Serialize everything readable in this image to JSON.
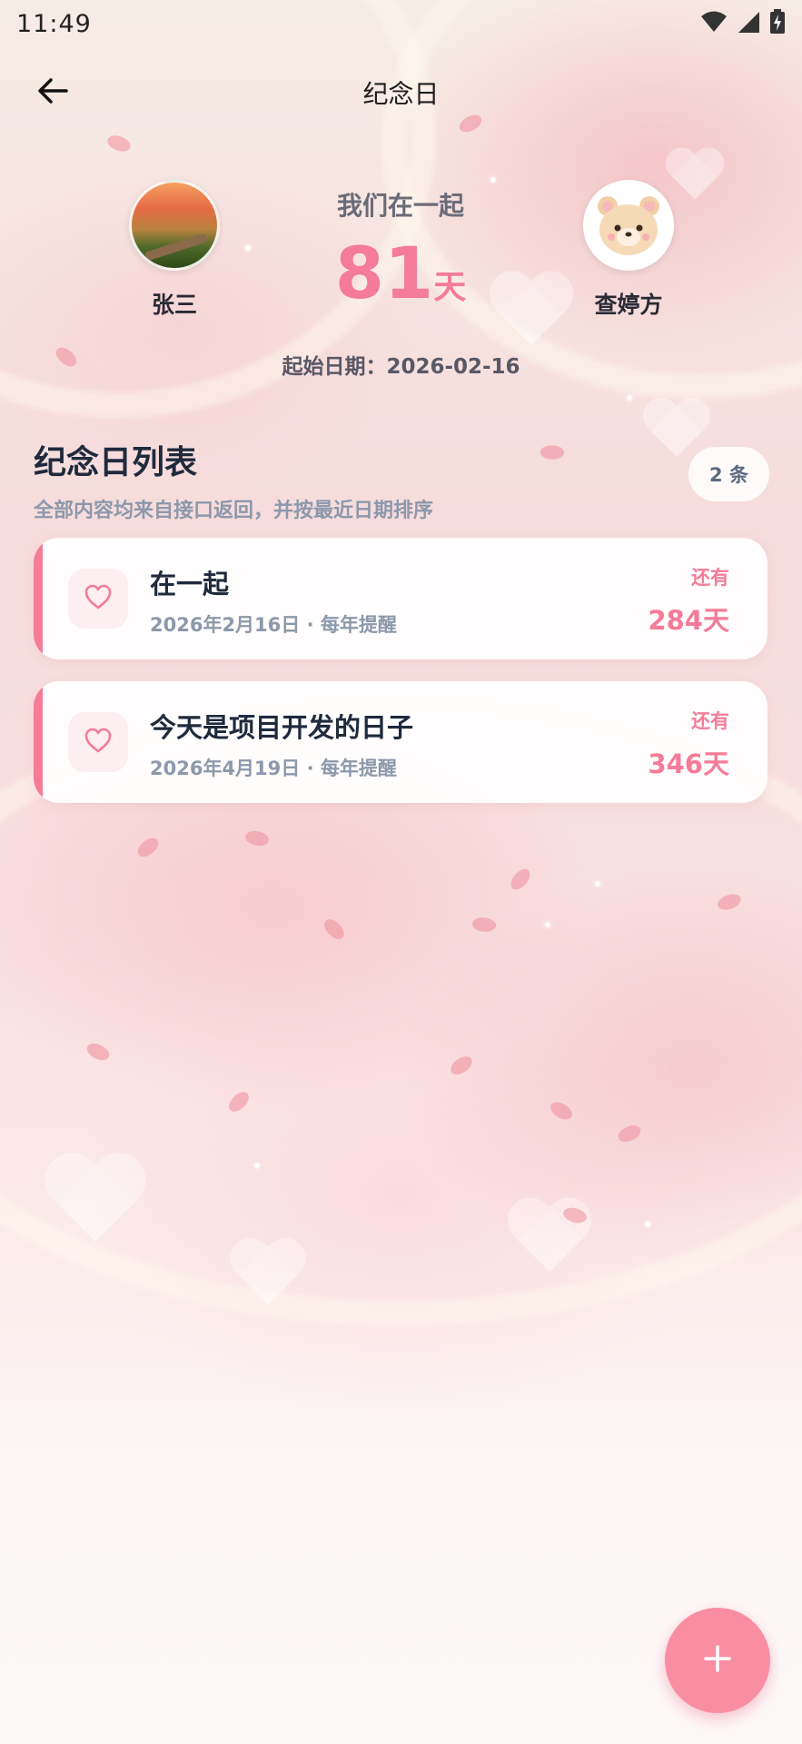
{
  "status_bar": {
    "time": "11:49",
    "icons": [
      "wifi-icon",
      "signal-icon",
      "battery-charging-icon"
    ]
  },
  "app_bar": {
    "title": "纪念日",
    "back_icon": "arrow-left-icon"
  },
  "couple": {
    "left_person": {
      "name": "张三",
      "avatar": "great-wall-landscape-photo"
    },
    "right_person": {
      "name": "查婷方",
      "avatar": "bear-cartoon"
    },
    "together_label": "我们在一起",
    "days_number": "81",
    "days_unit": "天",
    "start_date": "起始日期：2026-02-16"
  },
  "list": {
    "title": "纪念日列表",
    "subtitle": "全部内容均来自接口返回，并按最近日期排序",
    "count_badge": "2 条",
    "items": [
      {
        "title": "在一起",
        "meta": "2026年2月16日 · 每年提醒",
        "remain_label": "还有",
        "remain_days": "284天",
        "icon": "heart-icon"
      },
      {
        "title": "今天是项目开发的日子",
        "meta": "2026年4月19日 · 每年提醒",
        "remain_label": "还有",
        "remain_days": "346天",
        "icon": "heart-icon"
      }
    ]
  },
  "fab": {
    "icon": "plus-icon"
  },
  "colors": {
    "accent": "#f47c98",
    "fab": "#f98ea3",
    "title_text": "#1f2a3d",
    "muted_text": "#8c98ab"
  }
}
